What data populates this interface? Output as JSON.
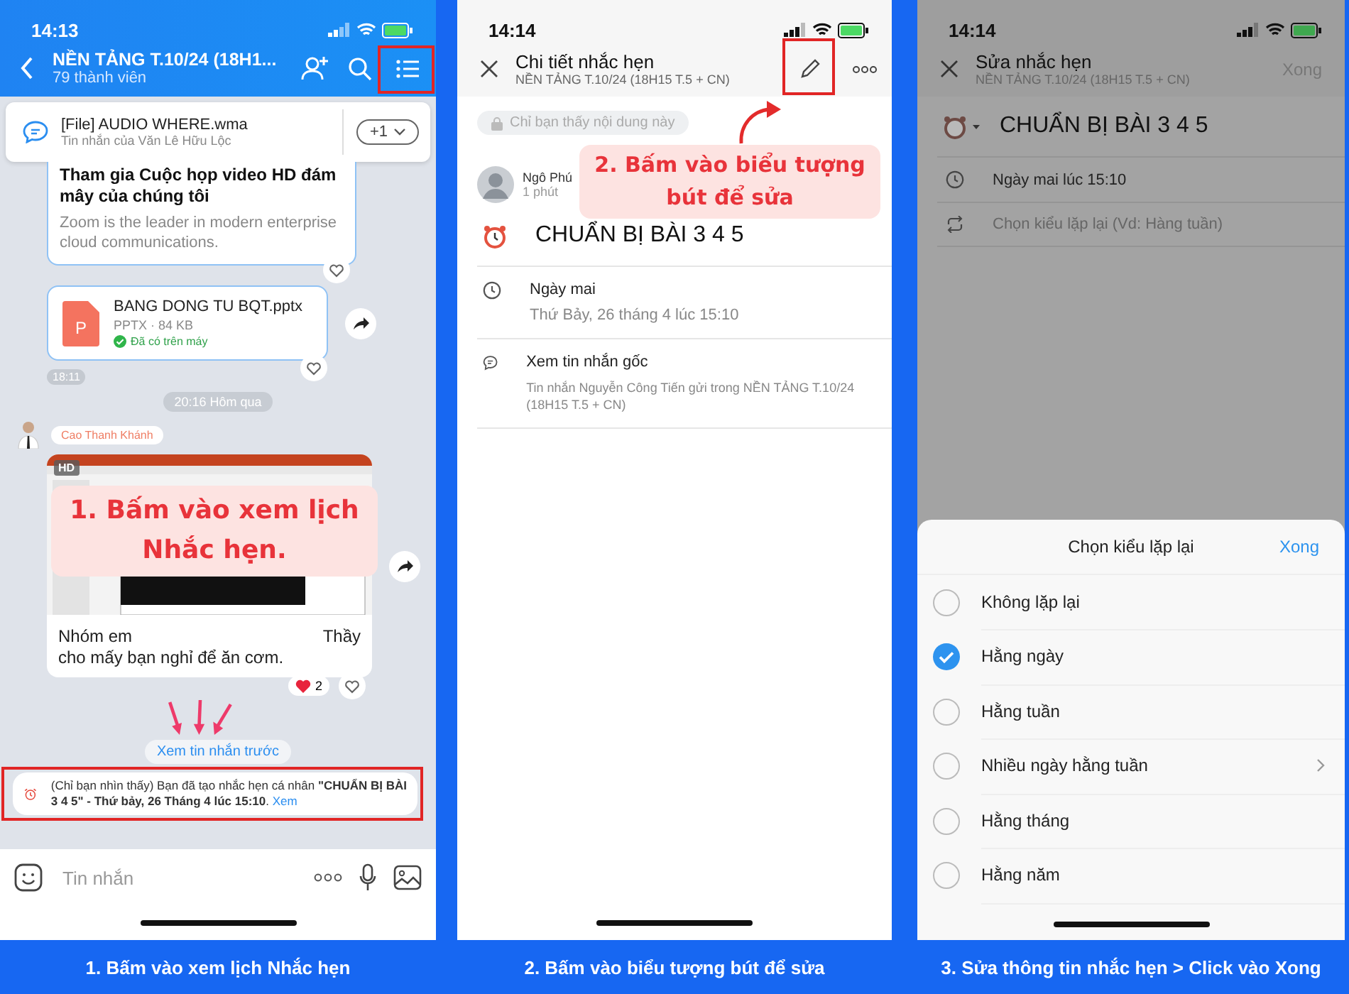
{
  "chat_screen": {
    "status_time": "14:13",
    "title": "NỀN TẢNG T.10/24 (18H1...",
    "subtitle": "79 thành viên",
    "pinned": {
      "title": "[File] AUDIO WHERE.wma",
      "subtitle": "Tin nhắn của Văn Lê Hữu Lộc",
      "count": "+1"
    },
    "link_card": {
      "title": "Tham gia Cuộc họp video HD đám mây của chúng tôi",
      "description": "Zoom is the leader in modern enterprise cloud communications."
    },
    "file": {
      "name": "BANG DONG TU BQT.pptx",
      "type_letter": "P",
      "meta": "PPTX · 84 KB",
      "status": "Đã có trên máy",
      "time": "18:11"
    },
    "date_divider": "20:16 Hôm qua",
    "sender": "Cao Thanh Khánh",
    "image_badge": "HD",
    "message_start": "Nhóm em",
    "message_end": "Thầy",
    "message_line2": "cho mấy bạn nghỉ để ăn cơm.",
    "reaction_count": "2",
    "load_more": "Xem tin nhắn trước",
    "notice": "(Chỉ bạn nhìn thấy) Bạn đã tạo nhắc hẹn cá nhân **\"CHUẨN BỊ BÀI 3 4 5\" - Thứ bảy, 26 Tháng 4 lúc 15:10**.",
    "notice_link": "Xem",
    "input_placeholder": "Tin nhắn",
    "callout": "1. Bấm vào xem lịch Nhắc hẹn."
  },
  "reminder_detail_screen": {
    "status_time": "14:14",
    "title": "Chi tiết nhắc hẹn",
    "subtitle": "NỀN TẢNG T.10/24 (18H15 T.5 + CN)",
    "privacy": "Chỉ bạn thấy nội dung này",
    "author": "Ngô Phú",
    "time_ago": "1 phút",
    "reminder_title": "CHUẨN BỊ BÀI 3 4 5",
    "rows": [
      {
        "kind": "time",
        "title": "Ngày mai",
        "detail": "Thứ Bảy, 26 tháng 4 lúc 15:10"
      },
      {
        "kind": "message",
        "title": "Xem tin nhắn gốc",
        "detail": "Tin nhắn Nguyễn Công Tiến gửi trong NỀN TẢNG T.10/24 (18H15 T.5 + CN)"
      }
    ],
    "callout": "2. Bấm vào biểu tượng bút để sửa"
  },
  "edit_reminder_screen": {
    "status_time": "14:14",
    "title": "Sửa nhắc hẹn",
    "subtitle": "NỀN TẢNG T.10/24 (18H15 T.5 + CN)",
    "done": {
      "label": "Xong",
      "disabled": true
    },
    "reminder_title": "CHUẨN BỊ BÀI 3 4 5",
    "rows": [
      {
        "kind": "time",
        "text": "Ngày mai lúc 15:10"
      },
      {
        "kind": "repeat",
        "text": "Chọn kiểu lặp lại (Vd: Hàng tuần)"
      }
    ],
    "sheet": {
      "title": "Chọn kiểu lặp lại",
      "done": "Xong",
      "options": [
        {
          "label": "Không lặp lại",
          "selected": false,
          "submenu": false
        },
        {
          "label": "Hằng ngày",
          "selected": true,
          "submenu": false
        },
        {
          "label": "Hằng tuần",
          "selected": false,
          "submenu": false
        },
        {
          "label": "Nhiều ngày hằng tuần",
          "selected": false,
          "submenu": true
        },
        {
          "label": "Hằng tháng",
          "selected": false,
          "submenu": false
        },
        {
          "label": "Hằng năm",
          "selected": false,
          "submenu": false
        }
      ]
    }
  },
  "captions": [
    "1. Bấm vào xem lịch Nhắc hẹn",
    "2. Bấm vào biểu tượng bút để sửa",
    "3.  Sửa thông tin nhắc hẹn > Click vào Xong"
  ]
}
